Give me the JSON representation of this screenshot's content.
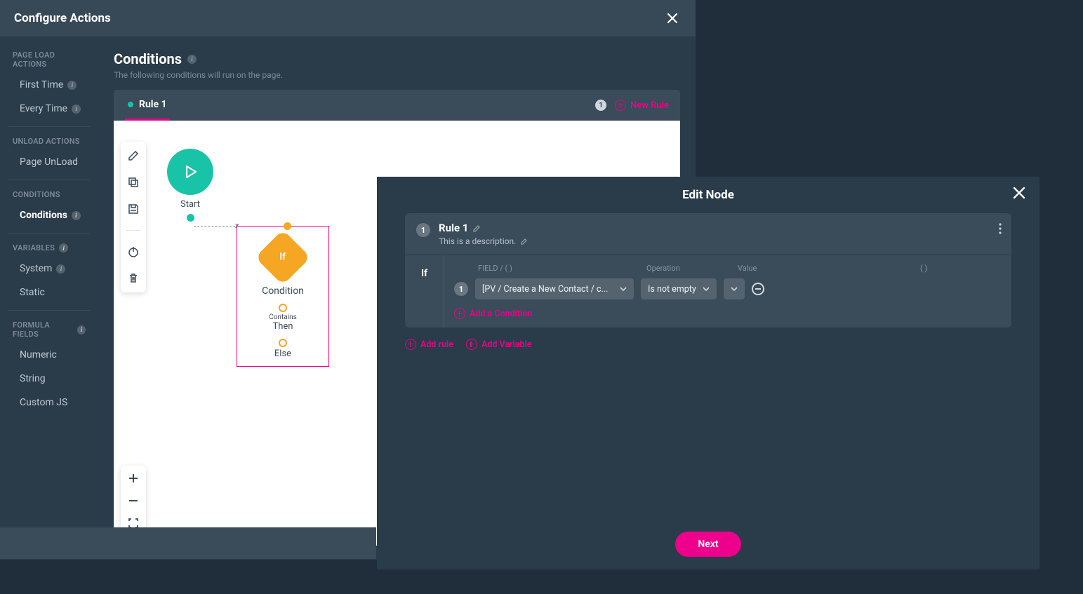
{
  "modal": {
    "title": "Configure Actions"
  },
  "sidebar": {
    "sections": [
      {
        "title": "PAGE LOAD ACTIONS",
        "items": [
          {
            "label": "First Time",
            "info": true
          },
          {
            "label": "Every Time",
            "info": true
          }
        ]
      },
      {
        "title": "UNLOAD ACTIONS",
        "items": [
          {
            "label": "Page UnLoad"
          }
        ]
      },
      {
        "title": "CONDITIONS",
        "items": [
          {
            "label": "Conditions",
            "info": true,
            "active": true
          }
        ]
      },
      {
        "title": "VARIABLES",
        "titleInfo": true,
        "items": [
          {
            "label": "System",
            "info": true
          },
          {
            "label": "Static"
          }
        ]
      },
      {
        "title": "FORMULA FIELDS",
        "titleInfo": true,
        "items": [
          {
            "label": "Numeric"
          },
          {
            "label": "String"
          },
          {
            "label": "Custom JS"
          }
        ]
      }
    ]
  },
  "content": {
    "title": "Conditions",
    "subtitle": "The following conditions will run on the page.",
    "tab": {
      "label": "Rule 1",
      "count": "1"
    },
    "newRule": "New Rule"
  },
  "canvas": {
    "start": "Start",
    "condition": {
      "diamond": "If",
      "label": "Condition",
      "mid": "Contains",
      "then": "Then",
      "else": "Else"
    },
    "edgeClose": "x"
  },
  "editPanel": {
    "title": "Edit Node",
    "rule": {
      "num": "1",
      "name": "Rule 1",
      "desc": "This is a description."
    },
    "ifLabel": "If",
    "headers": {
      "field": "FIELD / ( )",
      "operation": "Operation",
      "value": "Value",
      "paren": "( )"
    },
    "row": {
      "num": "1",
      "field": "[PV / Create a New Contact / c...",
      "op": "Is not empty"
    },
    "addCondition": "Add a Condition",
    "addRule": "Add rule",
    "addVariable": "Add Variable",
    "next": "Next"
  }
}
